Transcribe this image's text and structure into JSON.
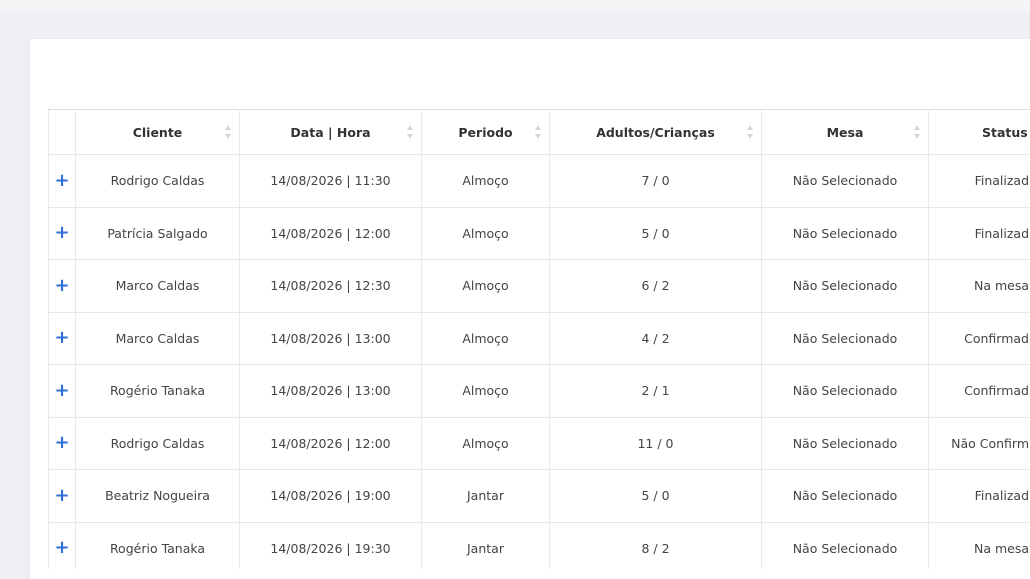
{
  "table": {
    "columns": [
      "Cliente",
      "Data | Hora",
      "Periodo",
      "Adultos/Crianças",
      "Mesa",
      "Status"
    ],
    "rows": [
      {
        "cliente": "Rodrigo Caldas",
        "data_hora": "14/08/2026 | 11:30",
        "periodo": "Almoço",
        "adultos_criancas": "7 / 0",
        "mesa": "Não Selecionado",
        "status": "Finalizad"
      },
      {
        "cliente": "Patrícia Salgado",
        "data_hora": "14/08/2026 | 12:00",
        "periodo": "Almoço",
        "adultos_criancas": "5 / 0",
        "mesa": "Não Selecionado",
        "status": "Finalizad"
      },
      {
        "cliente": "Marco Caldas",
        "data_hora": "14/08/2026 | 12:30",
        "periodo": "Almoço",
        "adultos_criancas": "6 / 2",
        "mesa": "Não Selecionado",
        "status": "Na mesa"
      },
      {
        "cliente": "Marco Caldas",
        "data_hora": "14/08/2026 | 13:00",
        "periodo": "Almoço",
        "adultos_criancas": "4 / 2",
        "mesa": "Não Selecionado",
        "status": "Confirmad"
      },
      {
        "cliente": "Rogério Tanaka",
        "data_hora": "14/08/2026 | 13:00",
        "periodo": "Almoço",
        "adultos_criancas": "2 / 1",
        "mesa": "Não Selecionado",
        "status": "Confirmad"
      },
      {
        "cliente": "Rodrigo Caldas",
        "data_hora": "14/08/2026 | 12:00",
        "periodo": "Almoço",
        "adultos_criancas": "11 / 0",
        "mesa": "Não Selecionado",
        "status": "Não Confirm"
      },
      {
        "cliente": "Beatriz Nogueira",
        "data_hora": "14/08/2026 | 19:00",
        "periodo": "Jantar",
        "adultos_criancas": "5 / 0",
        "mesa": "Não Selecionado",
        "status": "Finalizad"
      },
      {
        "cliente": "Rogério Tanaka",
        "data_hora": "14/08/2026 | 19:30",
        "periodo": "Jantar",
        "adultos_criancas": "8 / 2",
        "mesa": "Não Selecionado",
        "status": "Na mesa"
      }
    ]
  },
  "icons": {
    "expand": "plus-icon",
    "sort": "sort-icon"
  },
  "colors": {
    "accent": "#2f6fd6",
    "border": "#e8e8e8",
    "background": "#eef0f3"
  }
}
